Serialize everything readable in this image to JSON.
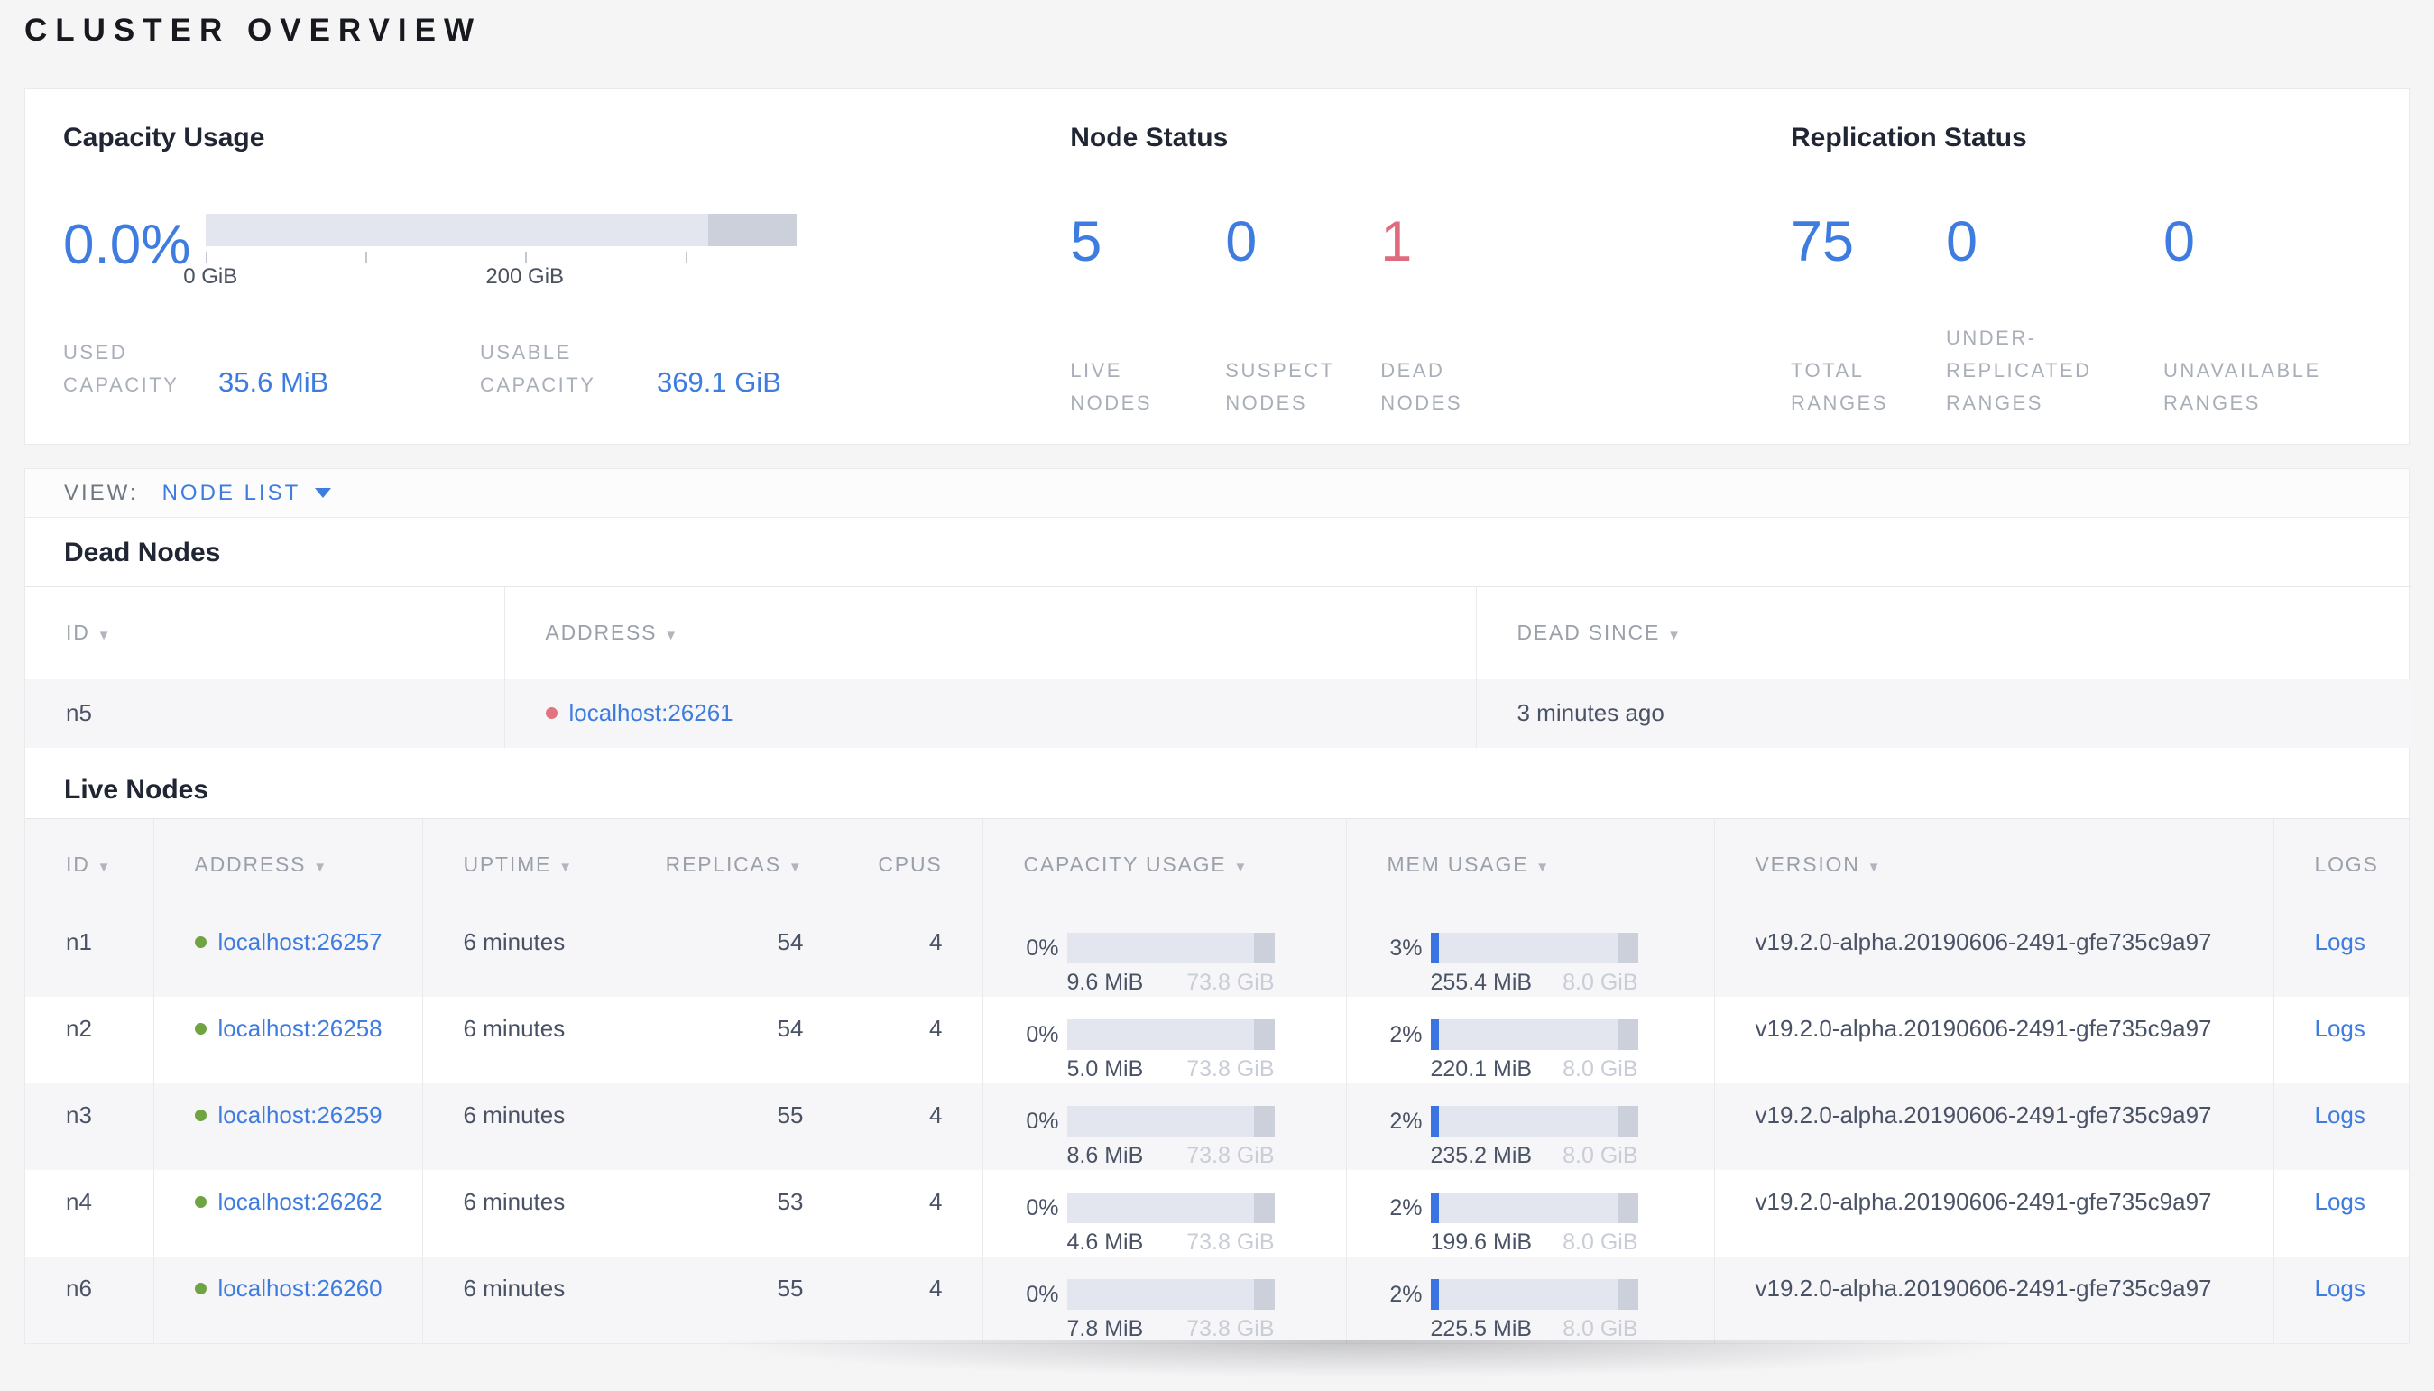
{
  "page": {
    "title": "CLUSTER OVERVIEW"
  },
  "icons": {
    "sort_caret": "▼"
  },
  "summary": {
    "capacity": {
      "title": "Capacity Usage",
      "percent": "0.0%",
      "percent_fraction": 0,
      "axis_labels": [
        "0 GiB",
        "200 GiB"
      ],
      "used_label": "USED CAPACITY",
      "used_value": "35.6 MiB",
      "usable_label": "USABLE CAPACITY",
      "usable_value": "369.1 GiB"
    },
    "node_status": {
      "title": "Node Status",
      "stats": [
        {
          "value": "5",
          "label": "LIVE NODES",
          "color": "blue"
        },
        {
          "value": "0",
          "label": "SUSPECT NODES",
          "color": "blue"
        },
        {
          "value": "1",
          "label": "DEAD NODES",
          "color": "red"
        }
      ]
    },
    "replication": {
      "title": "Replication Status",
      "stats": [
        {
          "value": "75",
          "label": "TOTAL RANGES",
          "color": "blue"
        },
        {
          "value": "0",
          "label": "UNDER-REPLICATED RANGES",
          "color": "blue"
        },
        {
          "value": "0",
          "label": "UNAVAILABLE RANGES",
          "color": "blue"
        }
      ]
    }
  },
  "view_bar": {
    "label": "VIEW:",
    "selected": "NODE LIST"
  },
  "dead_nodes": {
    "title": "Dead Nodes",
    "columns": [
      {
        "key": "id",
        "label": "ID",
        "sortable": true
      },
      {
        "key": "address",
        "label": "ADDRESS",
        "sortable": true
      },
      {
        "key": "dead_since",
        "label": "DEAD SINCE",
        "sortable": true
      }
    ],
    "rows": [
      {
        "id": "n5",
        "address": "localhost:26261",
        "dead_since": "3 minutes ago"
      }
    ]
  },
  "live_nodes": {
    "title": "Live Nodes",
    "columns": [
      {
        "key": "id",
        "label": "ID",
        "sortable": true,
        "align": "left"
      },
      {
        "key": "address",
        "label": "ADDRESS",
        "sortable": true,
        "align": "left"
      },
      {
        "key": "uptime",
        "label": "UPTIME",
        "sortable": true,
        "align": "left"
      },
      {
        "key": "replicas",
        "label": "REPLICAS",
        "sortable": true,
        "align": "right"
      },
      {
        "key": "cpus",
        "label": "CPUS",
        "sortable": false,
        "align": "right"
      },
      {
        "key": "capacity",
        "label": "CAPACITY USAGE",
        "sortable": true,
        "align": "left"
      },
      {
        "key": "memory",
        "label": "MEM USAGE",
        "sortable": true,
        "align": "left"
      },
      {
        "key": "version",
        "label": "VERSION",
        "sortable": true,
        "align": "left"
      },
      {
        "key": "logs",
        "label": "LOGS",
        "sortable": false,
        "align": "left"
      }
    ],
    "rows": [
      {
        "id": "n1",
        "address": "localhost:26257",
        "uptime": "6 minutes",
        "replicas": "54",
        "cpus": "4",
        "capacity": {
          "percent": "0%",
          "used": "9.6 MiB",
          "total": "73.8 GiB"
        },
        "memory": {
          "percent": "3%",
          "used": "255.4 MiB",
          "total": "8.0 GiB"
        },
        "version": "v19.2.0-alpha.20190606-2491-gfe735c9a97",
        "logs": "Logs"
      },
      {
        "id": "n2",
        "address": "localhost:26258",
        "uptime": "6 minutes",
        "replicas": "54",
        "cpus": "4",
        "capacity": {
          "percent": "0%",
          "used": "5.0 MiB",
          "total": "73.8 GiB"
        },
        "memory": {
          "percent": "2%",
          "used": "220.1 MiB",
          "total": "8.0 GiB"
        },
        "version": "v19.2.0-alpha.20190606-2491-gfe735c9a97",
        "logs": "Logs"
      },
      {
        "id": "n3",
        "address": "localhost:26259",
        "uptime": "6 minutes",
        "replicas": "55",
        "cpus": "4",
        "capacity": {
          "percent": "0%",
          "used": "8.6 MiB",
          "total": "73.8 GiB"
        },
        "memory": {
          "percent": "2%",
          "used": "235.2 MiB",
          "total": "8.0 GiB"
        },
        "version": "v19.2.0-alpha.20190606-2491-gfe735c9a97",
        "logs": "Logs"
      },
      {
        "id": "n4",
        "address": "localhost:26262",
        "uptime": "6 minutes",
        "replicas": "53",
        "cpus": "4",
        "capacity": {
          "percent": "0%",
          "used": "4.6 MiB",
          "total": "73.8 GiB"
        },
        "memory": {
          "percent": "2%",
          "used": "199.6 MiB",
          "total": "8.0 GiB"
        },
        "version": "v19.2.0-alpha.20190606-2491-gfe735c9a97",
        "logs": "Logs"
      },
      {
        "id": "n6",
        "address": "localhost:26260",
        "uptime": "6 minutes",
        "replicas": "55",
        "cpus": "4",
        "capacity": {
          "percent": "0%",
          "used": "7.8 MiB",
          "total": "73.8 GiB"
        },
        "memory": {
          "percent": "2%",
          "used": "225.5 MiB",
          "total": "8.0 GiB"
        },
        "version": "v19.2.0-alpha.20190606-2491-gfe735c9a97",
        "logs": "Logs"
      }
    ]
  },
  "colors": {
    "accent_blue": "#3e7ce0",
    "status_red": "#df6b7c",
    "live_dot_green": "#70a341",
    "dead_dot_red": "#e2747f",
    "bar_track": "#e3e6ee",
    "bar_reserved": "#ccd0da",
    "bar_fill": "#3b73e3"
  }
}
